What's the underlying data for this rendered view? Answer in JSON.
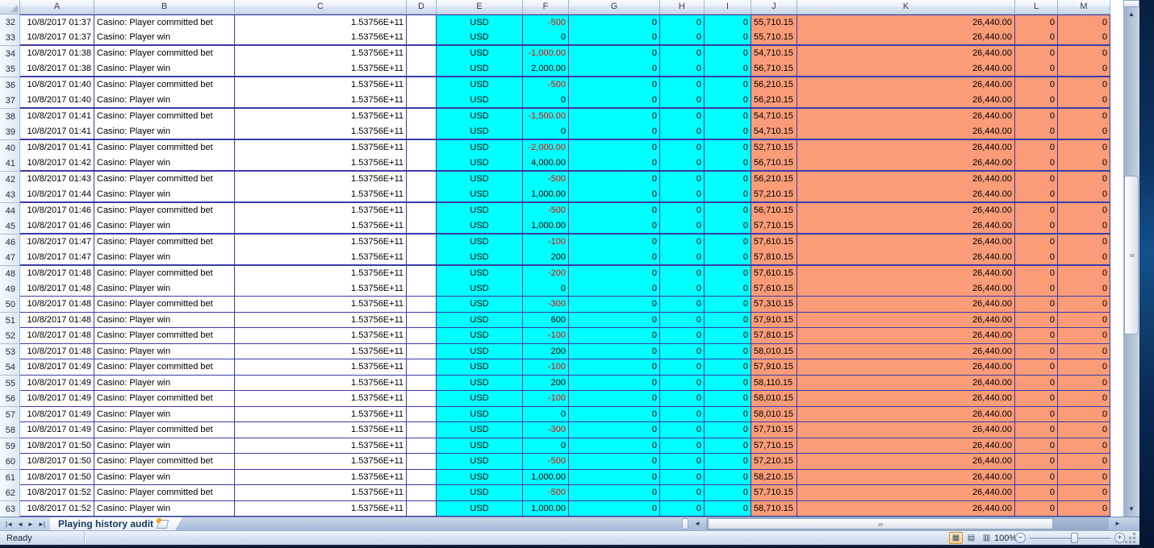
{
  "grid": {
    "column_headers": [
      "A",
      "B",
      "C",
      "D",
      "E",
      "F",
      "G",
      "H",
      "I",
      "J",
      "K",
      "L",
      "M"
    ],
    "rows": [
      {
        "n": "32",
        "a": "10/8/2017 01:37",
        "b": "Casino: Player committed bet",
        "c": "1.53756E+11",
        "d": "",
        "e": "USD",
        "f": "-500",
        "g": "0",
        "h": "0",
        "i": "0",
        "j": "55,710.15",
        "k": "26,440.00",
        "l": "0",
        "m": "0"
      },
      {
        "n": "33",
        "a": "10/8/2017 01:37",
        "b": "Casino: Player win",
        "c": "1.53756E+11",
        "d": "",
        "e": "USD",
        "f": "0",
        "g": "0",
        "h": "0",
        "i": "0",
        "j": "55,710.15",
        "k": "26,440.00",
        "l": "0",
        "m": "0"
      },
      {
        "n": "34",
        "a": "10/8/2017 01:38",
        "b": "Casino: Player committed bet",
        "c": "1.53756E+11",
        "d": "",
        "e": "USD",
        "f": "-1,000.00",
        "g": "0",
        "h": "0",
        "i": "0",
        "j": "54,710.15",
        "k": "26,440.00",
        "l": "0",
        "m": "0"
      },
      {
        "n": "35",
        "a": "10/8/2017 01:38",
        "b": "Casino: Player win",
        "c": "1.53756E+11",
        "d": "",
        "e": "USD",
        "f": "2,000.00",
        "g": "0",
        "h": "0",
        "i": "0",
        "j": "56,710.15",
        "k": "26,440.00",
        "l": "0",
        "m": "0"
      },
      {
        "n": "36",
        "a": "10/8/2017 01:40",
        "b": "Casino: Player committed bet",
        "c": "1.53756E+11",
        "d": "",
        "e": "USD",
        "f": "-500",
        "g": "0",
        "h": "0",
        "i": "0",
        "j": "56,210.15",
        "k": "26,440.00",
        "l": "0",
        "m": "0"
      },
      {
        "n": "37",
        "a": "10/8/2017 01:40",
        "b": "Casino: Player win",
        "c": "1.53756E+11",
        "d": "",
        "e": "USD",
        "f": "0",
        "g": "0",
        "h": "0",
        "i": "0",
        "j": "56,210.15",
        "k": "26,440.00",
        "l": "0",
        "m": "0"
      },
      {
        "n": "38",
        "a": "10/8/2017 01:41",
        "b": "Casino: Player committed bet",
        "c": "1.53756E+11",
        "d": "",
        "e": "USD",
        "f": "-1,500.00",
        "g": "0",
        "h": "0",
        "i": "0",
        "j": "54,710.15",
        "k": "26,440.00",
        "l": "0",
        "m": "0"
      },
      {
        "n": "39",
        "a": "10/8/2017 01:41",
        "b": "Casino: Player win",
        "c": "1.53756E+11",
        "d": "",
        "e": "USD",
        "f": "0",
        "g": "0",
        "h": "0",
        "i": "0",
        "j": "54,710.15",
        "k": "26,440.00",
        "l": "0",
        "m": "0"
      },
      {
        "n": "40",
        "a": "10/8/2017 01:41",
        "b": "Casino: Player committed bet",
        "c": "1.53756E+11",
        "d": "",
        "e": "USD",
        "f": "-2,000.00",
        "g": "0",
        "h": "0",
        "i": "0",
        "j": "52,710.15",
        "k": "26,440.00",
        "l": "0",
        "m": "0"
      },
      {
        "n": "41",
        "a": "10/8/2017 01:42",
        "b": "Casino: Player win",
        "c": "1.53756E+11",
        "d": "",
        "e": "USD",
        "f": "4,000.00",
        "g": "0",
        "h": "0",
        "i": "0",
        "j": "56,710.15",
        "k": "26,440.00",
        "l": "0",
        "m": "0"
      },
      {
        "n": "42",
        "a": "10/8/2017 01:43",
        "b": "Casino: Player committed bet",
        "c": "1.53756E+11",
        "d": "",
        "e": "USD",
        "f": "-500",
        "g": "0",
        "h": "0",
        "i": "0",
        "j": "56,210.15",
        "k": "26,440.00",
        "l": "0",
        "m": "0"
      },
      {
        "n": "43",
        "a": "10/8/2017 01:44",
        "b": "Casino: Player win",
        "c": "1.53756E+11",
        "d": "",
        "e": "USD",
        "f": "1,000.00",
        "g": "0",
        "h": "0",
        "i": "0",
        "j": "57,210.15",
        "k": "26,440.00",
        "l": "0",
        "m": "0"
      },
      {
        "n": "44",
        "a": "10/8/2017 01:46",
        "b": "Casino: Player committed bet",
        "c": "1.53756E+11",
        "d": "",
        "e": "USD",
        "f": "-500",
        "g": "0",
        "h": "0",
        "i": "0",
        "j": "56,710.15",
        "k": "26,440.00",
        "l": "0",
        "m": "0"
      },
      {
        "n": "45",
        "a": "10/8/2017 01:46",
        "b": "Casino: Player win",
        "c": "1.53756E+11",
        "d": "",
        "e": "USD",
        "f": "1,000.00",
        "g": "0",
        "h": "0",
        "i": "0",
        "j": "57,710.15",
        "k": "26,440.00",
        "l": "0",
        "m": "0"
      },
      {
        "n": "46",
        "a": "10/8/2017 01:47",
        "b": "Casino: Player committed bet",
        "c": "1.53756E+11",
        "d": "",
        "e": "USD",
        "f": "-100",
        "g": "0",
        "h": "0",
        "i": "0",
        "j": "57,610.15",
        "k": "26,440.00",
        "l": "0",
        "m": "0"
      },
      {
        "n": "47",
        "a": "10/8/2017 01:47",
        "b": "Casino: Player win",
        "c": "1.53756E+11",
        "d": "",
        "e": "USD",
        "f": "200",
        "g": "0",
        "h": "0",
        "i": "0",
        "j": "57,810.15",
        "k": "26,440.00",
        "l": "0",
        "m": "0"
      },
      {
        "n": "48",
        "a": "10/8/2017 01:48",
        "b": "Casino: Player committed bet",
        "c": "1.53756E+11",
        "d": "",
        "e": "USD",
        "f": "-200",
        "g": "0",
        "h": "0",
        "i": "0",
        "j": "57,610.15",
        "k": "26,440.00",
        "l": "0",
        "m": "0"
      },
      {
        "n": "49",
        "a": "10/8/2017 01:48",
        "b": "Casino: Player win",
        "c": "1.53756E+11",
        "d": "",
        "e": "USD",
        "f": "0",
        "g": "0",
        "h": "0",
        "i": "0",
        "j": "57,610.15",
        "k": "26,440.00",
        "l": "0",
        "m": "0"
      },
      {
        "n": "50",
        "a": "10/8/2017 01:48",
        "b": "Casino: Player committed bet",
        "c": "1.53756E+11",
        "d": "",
        "e": "USD",
        "f": "-300",
        "g": "0",
        "h": "0",
        "i": "0",
        "j": "57,310.15",
        "k": "26,440.00",
        "l": "0",
        "m": "0"
      },
      {
        "n": "51",
        "a": "10/8/2017 01:48",
        "b": "Casino: Player win",
        "c": "1.53756E+11",
        "d": "",
        "e": "USD",
        "f": "600",
        "g": "0",
        "h": "0",
        "i": "0",
        "j": "57,910.15",
        "k": "26,440.00",
        "l": "0",
        "m": "0"
      },
      {
        "n": "52",
        "a": "10/8/2017 01:48",
        "b": "Casino: Player committed bet",
        "c": "1.53756E+11",
        "d": "",
        "e": "USD",
        "f": "-100",
        "g": "0",
        "h": "0",
        "i": "0",
        "j": "57,810.15",
        "k": "26,440.00",
        "l": "0",
        "m": "0"
      },
      {
        "n": "53",
        "a": "10/8/2017 01:48",
        "b": "Casino: Player win",
        "c": "1.53756E+11",
        "d": "",
        "e": "USD",
        "f": "200",
        "g": "0",
        "h": "0",
        "i": "0",
        "j": "58,010.15",
        "k": "26,440.00",
        "l": "0",
        "m": "0"
      },
      {
        "n": "54",
        "a": "10/8/2017 01:49",
        "b": "Casino: Player committed bet",
        "c": "1.53756E+11",
        "d": "",
        "e": "USD",
        "f": "-100",
        "g": "0",
        "h": "0",
        "i": "0",
        "j": "57,910.15",
        "k": "26,440.00",
        "l": "0",
        "m": "0"
      },
      {
        "n": "55",
        "a": "10/8/2017 01:49",
        "b": "Casino: Player win",
        "c": "1.53756E+11",
        "d": "",
        "e": "USD",
        "f": "200",
        "g": "0",
        "h": "0",
        "i": "0",
        "j": "58,110.15",
        "k": "26,440.00",
        "l": "0",
        "m": "0"
      },
      {
        "n": "56",
        "a": "10/8/2017 01:49",
        "b": "Casino: Player committed bet",
        "c": "1.53756E+11",
        "d": "",
        "e": "USD",
        "f": "-100",
        "g": "0",
        "h": "0",
        "i": "0",
        "j": "58,010.15",
        "k": "26,440.00",
        "l": "0",
        "m": "0"
      },
      {
        "n": "57",
        "a": "10/8/2017 01:49",
        "b": "Casino: Player win",
        "c": "1.53756E+11",
        "d": "",
        "e": "USD",
        "f": "0",
        "g": "0",
        "h": "0",
        "i": "0",
        "j": "58,010.15",
        "k": "26,440.00",
        "l": "0",
        "m": "0"
      },
      {
        "n": "58",
        "a": "10/8/2017 01:49",
        "b": "Casino: Player committed bet",
        "c": "1.53756E+11",
        "d": "",
        "e": "USD",
        "f": "-300",
        "g": "0",
        "h": "0",
        "i": "0",
        "j": "57,710.15",
        "k": "26,440.00",
        "l": "0",
        "m": "0"
      },
      {
        "n": "59",
        "a": "10/8/2017 01:50",
        "b": "Casino: Player win",
        "c": "1.53756E+11",
        "d": "",
        "e": "USD",
        "f": "0",
        "g": "0",
        "h": "0",
        "i": "0",
        "j": "57,710.15",
        "k": "26,440.00",
        "l": "0",
        "m": "0"
      },
      {
        "n": "60",
        "a": "10/8/2017 01:50",
        "b": "Casino: Player committed bet",
        "c": "1.53756E+11",
        "d": "",
        "e": "USD",
        "f": "-500",
        "g": "0",
        "h": "0",
        "i": "0",
        "j": "57,210.15",
        "k": "26,440.00",
        "l": "0",
        "m": "0"
      },
      {
        "n": "61",
        "a": "10/8/2017 01:50",
        "b": "Casino: Player win",
        "c": "1.53756E+11",
        "d": "",
        "e": "USD",
        "f": "1,000.00",
        "g": "0",
        "h": "0",
        "i": "0",
        "j": "58,210.15",
        "k": "26,440.00",
        "l": "0",
        "m": "0"
      },
      {
        "n": "62",
        "a": "10/8/2017 01:52",
        "b": "Casino: Player committed bet",
        "c": "1.53756E+11",
        "d": "",
        "e": "USD",
        "f": "-500",
        "g": "0",
        "h": "0",
        "i": "0",
        "j": "57,710.15",
        "k": "26,440.00",
        "l": "0",
        "m": "0"
      },
      {
        "n": "63",
        "a": "10/8/2017 01:52",
        "b": "Casino: Player win",
        "c": "1.53756E+11",
        "d": "",
        "e": "USD",
        "f": "1,000.00",
        "g": "0",
        "h": "0",
        "i": "0",
        "j": "58,710.15",
        "k": "26,440.00",
        "l": "0",
        "m": "0"
      }
    ]
  },
  "tab_bar": {
    "nav_first": "|◄",
    "nav_prev": "◄",
    "nav_next": "►",
    "nav_last": "►|",
    "active_tab": "Playing history audit"
  },
  "scrollbars": {
    "up_arrow": "▲",
    "down_arrow": "▼",
    "left_arrow": "◄",
    "right_arrow": "►"
  },
  "status_bar": {
    "ready_label": "Ready",
    "zoom_level": "100%",
    "zoom_out": "−",
    "zoom_in": "+",
    "view_normal_icon": "▦",
    "view_page_layout_icon": "▤",
    "view_page_break_icon": "▥"
  },
  "colors": {
    "cyan_fill": "#00FFFF",
    "salmon_fill": "#FA9C78",
    "negative_text": "#FF0000",
    "grid_border": "#3B3BA8"
  }
}
